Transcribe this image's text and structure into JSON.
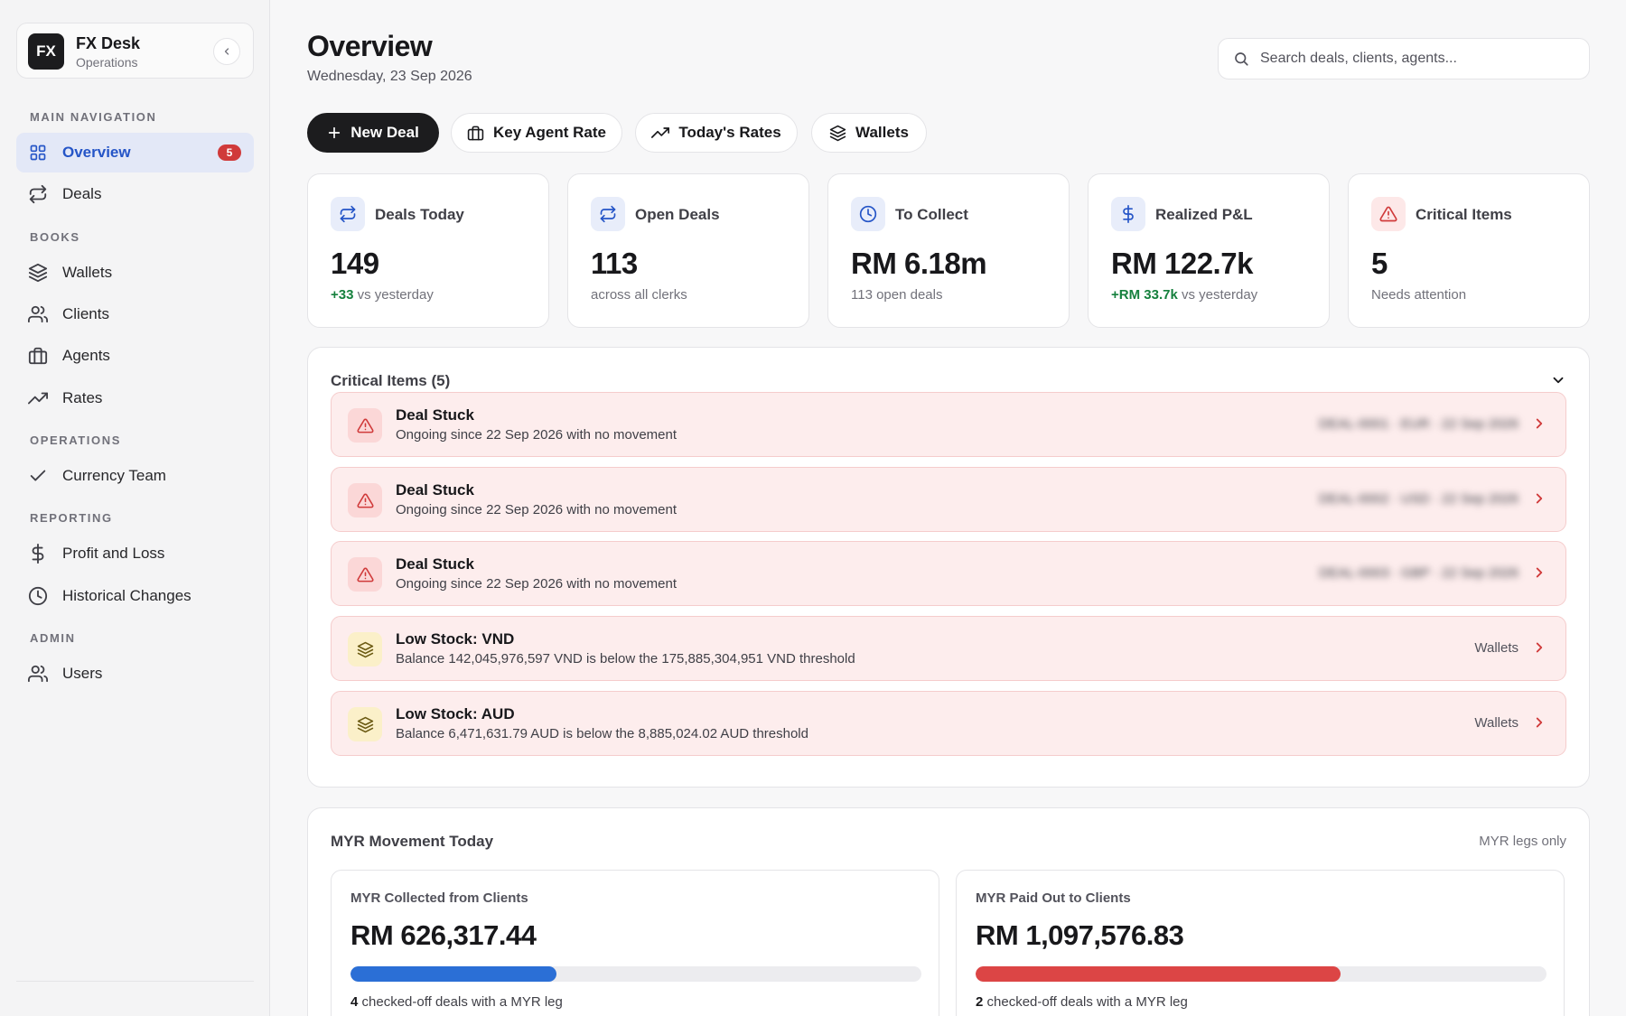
{
  "colors": {
    "accent": "#2555c7",
    "danger": "#d03a3a",
    "positive": "#15803d",
    "dark": "#1c1c1e",
    "collected_bar": "#2b6fd6",
    "paid_bar": "#dc4545"
  },
  "brand": {
    "logo": "FX",
    "title": "FX Desk",
    "subtitle": "Operations"
  },
  "sidebar": {
    "sections": [
      "MAIN NAVIGATION",
      "BOOKS",
      "OPERATIONS",
      "REPORTING",
      "ADMIN"
    ],
    "items": [
      {
        "label": "Overview",
        "icon": "grid-icon",
        "badge": "5",
        "active": true
      },
      {
        "label": "Deals",
        "icon": "swap-icon"
      },
      {
        "label": "Wallets",
        "icon": "layers-icon"
      },
      {
        "label": "Clients",
        "icon": "users-icon"
      },
      {
        "label": "Agents",
        "icon": "briefcase-icon"
      },
      {
        "label": "Rates",
        "icon": "trending-up-icon"
      },
      {
        "label": "Currency Team",
        "icon": "check-icon"
      },
      {
        "label": "Profit and Loss",
        "icon": "dollar-icon"
      },
      {
        "label": "Historical Changes",
        "icon": "clock-icon"
      },
      {
        "label": "Users",
        "icon": "users-icon"
      }
    ]
  },
  "header": {
    "title": "Overview",
    "date": "Wednesday, 23 Sep 2026"
  },
  "search": {
    "placeholder": "Search deals, clients, agents..."
  },
  "actions": [
    "New Deal",
    "Key Agent Rate",
    "Today's Rates",
    "Wallets"
  ],
  "stats": [
    {
      "label": "Deals Today",
      "value": "149",
      "delta": "+33",
      "sub": "vs yesterday",
      "icon": "swap-icon"
    },
    {
      "label": "Open Deals",
      "value": "113",
      "sub": "across all clerks",
      "icon": "swap-icon"
    },
    {
      "label": "To Collect",
      "value": "RM 6.18m",
      "sub": "113 open deals",
      "icon": "clock-icon"
    },
    {
      "label": "Realized P&L",
      "value": "RM 122.7k",
      "delta": "+RM 33.7k",
      "sub": "vs yesterday",
      "icon": "dollar-icon"
    },
    {
      "label": "Critical Items",
      "value": "5",
      "sub": "Needs attention",
      "icon": "alert-triangle-icon"
    }
  ],
  "critical": {
    "title": "Critical Items (5)",
    "items": [
      {
        "title": "Deal Stuck",
        "desc": "Ongoing since 22 Sep 2026 with no movement",
        "meta": "DEAL-0001 · EUR · 22 Sep 2026",
        "kind": "alert"
      },
      {
        "title": "Deal Stuck",
        "desc": "Ongoing since 22 Sep 2026 with no movement",
        "meta": "DEAL-0002 · USD · 22 Sep 2026",
        "kind": "alert"
      },
      {
        "title": "Deal Stuck",
        "desc": "Ongoing since 22 Sep 2026 with no movement",
        "meta": "DEAL-0003 · GBP · 22 Sep 2026",
        "kind": "alert"
      },
      {
        "title": "Low Stock: VND",
        "desc": "Balance 142,045,976,597 VND is below the 175,885,304,951 VND threshold",
        "meta": "Wallets",
        "kind": "stock"
      },
      {
        "title": "Low Stock: AUD",
        "desc": "Balance 6,471,631.79 AUD is below the 8,885,024.02 AUD threshold",
        "meta": "Wallets",
        "kind": "stock"
      }
    ]
  },
  "myr": {
    "title": "MYR Movement Today",
    "note": "MYR legs only",
    "collected": {
      "label": "MYR Collected from Clients",
      "value": "RM 626,317.44",
      "progress": 0.36,
      "count": "4",
      "foot": "checked-off deals with a MYR leg"
    },
    "paid": {
      "label": "MYR Paid Out to Clients",
      "value": "RM 1,097,576.83",
      "progress": 0.64,
      "count": "2",
      "foot": "checked-off deals with a MYR leg"
    }
  }
}
